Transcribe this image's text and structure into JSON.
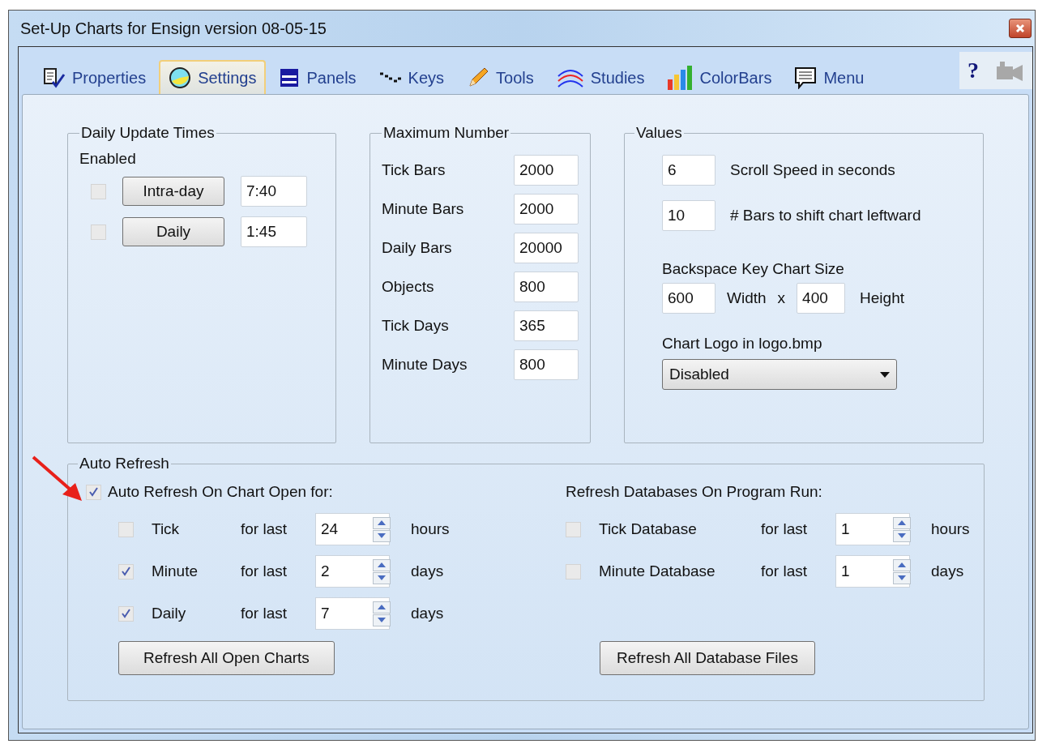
{
  "window": {
    "title": "Set-Up Charts for Ensign version 08-05-15",
    "help": "?"
  },
  "tabs": [
    {
      "label": "Properties",
      "selected": false
    },
    {
      "label": "Settings",
      "selected": true
    },
    {
      "label": "Panels",
      "selected": false
    },
    {
      "label": "Keys",
      "selected": false
    },
    {
      "label": "Tools",
      "selected": false
    },
    {
      "label": "Studies",
      "selected": false
    },
    {
      "label": "ColorBars",
      "selected": false
    },
    {
      "label": "Menu",
      "selected": false
    }
  ],
  "daily_update_times": {
    "title": "Daily Update Times",
    "enabled_label": "Enabled",
    "rows": [
      {
        "checked": false,
        "button": "Intra-day",
        "time": "7:40"
      },
      {
        "checked": false,
        "button": "Daily",
        "time": "1:45"
      }
    ]
  },
  "maximum_number": {
    "title": "Maximum Number",
    "rows": [
      {
        "label": "Tick Bars",
        "value": "2000"
      },
      {
        "label": "Minute Bars",
        "value": "2000"
      },
      {
        "label": "Daily Bars",
        "value": "20000"
      },
      {
        "label": "Objects",
        "value": "800"
      },
      {
        "label": "Tick Days",
        "value": "365"
      },
      {
        "label": "Minute Days",
        "value": "800"
      }
    ]
  },
  "values": {
    "title": "Values",
    "rows": [
      {
        "value": "6",
        "label": "Scroll Speed in seconds"
      },
      {
        "value": "10",
        "label": "# Bars to shift chart leftward"
      }
    ],
    "backspace": {
      "title": "Backspace Key Chart Size",
      "width_value": "600",
      "width_label": "Width",
      "times": "x",
      "height_value": "400",
      "height_label": "Height"
    },
    "logo": {
      "label": "Chart Logo in logo.bmp",
      "selection": "Disabled"
    }
  },
  "auto_refresh": {
    "title": "Auto Refresh",
    "open": {
      "checked": true,
      "label": "Auto Refresh On Chart Open for:"
    },
    "rows": [
      {
        "checked": false,
        "label": "Tick",
        "for_last": "for last",
        "value": "24",
        "unit": "hours"
      },
      {
        "checked": true,
        "label": "Minute",
        "for_last": "for last",
        "value": "2",
        "unit": "days"
      },
      {
        "checked": true,
        "label": "Daily",
        "for_last": "for last",
        "value": "7",
        "unit": "days"
      }
    ],
    "button": "Refresh All Open Charts",
    "databases": {
      "title": "Refresh Databases On Program Run:",
      "rows": [
        {
          "checked": false,
          "label": "Tick Database",
          "for_last": "for last",
          "value": "1",
          "unit": "hours"
        },
        {
          "checked": false,
          "label": "Minute Database",
          "for_last": "for last",
          "value": "1",
          "unit": "days"
        }
      ],
      "button": "Refresh All Database Files"
    }
  }
}
